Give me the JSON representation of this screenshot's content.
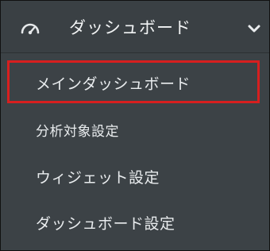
{
  "menu": {
    "header": {
      "label": "ダッシュボード",
      "icon": "dashboard-gauge-icon",
      "expanded_icon": "chevron-down-icon"
    },
    "items": [
      {
        "label": "メインダッシュボード",
        "selected": true
      },
      {
        "label": "分析対象設定",
        "selected": false
      },
      {
        "label": "ウィジェット設定",
        "selected": false
      },
      {
        "label": "ダッシュボード設定",
        "selected": false
      }
    ]
  },
  "colors": {
    "background": "#3f4549",
    "header_background": "#3a4044",
    "text": "#eceff1",
    "highlight_border": "#d71f1f"
  }
}
